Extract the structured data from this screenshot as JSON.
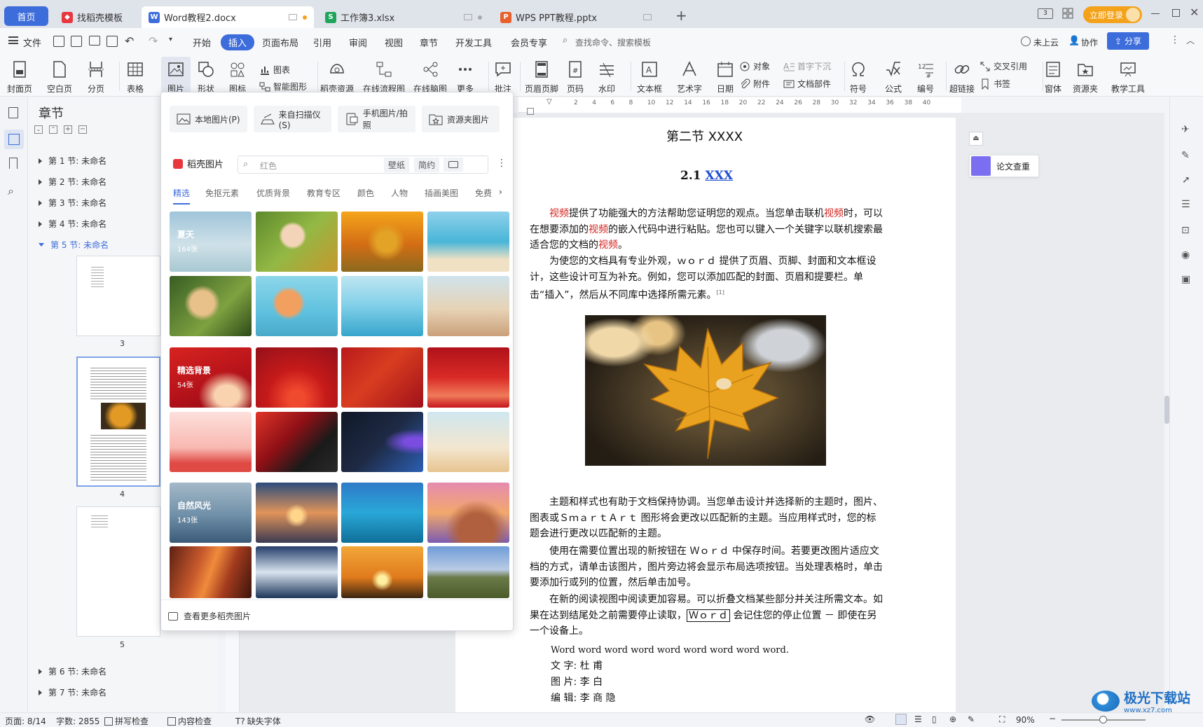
{
  "tabs": {
    "home": "首页",
    "t1": "找稻壳模板",
    "t2": "Word教程2.docx",
    "t3": "工作簿3.xlsx",
    "t4": "WPS PPT教程.pptx",
    "login": "立即登录"
  },
  "menu": {
    "file": "文件",
    "items": [
      "开始",
      "插入",
      "页面布局",
      "引用",
      "审阅",
      "视图",
      "章节",
      "开发工具",
      "会员专享"
    ],
    "search": "查找命令、搜索模板",
    "cloud": "未上云",
    "collab": "协作",
    "share": "分享"
  },
  "ribbon": {
    "cover": "封面页",
    "blank": "空白页",
    "pagebreak": "分页",
    "table": "表格",
    "picture": "图片",
    "shape": "形状",
    "icons": "图标",
    "chart": "图表",
    "smartart": "智能图形",
    "docer": "稻壳资源",
    "flow": "在线流程图",
    "mind": "在线脑图",
    "more": "更多",
    "comment": "批注",
    "headerfooter": "页眉页脚",
    "pagenum": "页码",
    "watermark": "水印",
    "textbox": "文本框",
    "wordart": "艺术字",
    "date": "日期",
    "object": "对象",
    "attach": "附件",
    "dropcap": "首字下沉",
    "docpart": "文档部件",
    "symbol": "符号",
    "formula": "公式",
    "number": "编号",
    "hyperlink": "超链接",
    "crossref": "交叉引用",
    "bookmark": "书签",
    "window": "窗体",
    "resource": "资源夹",
    "teach": "教学工具"
  },
  "nav": {
    "title": "章节",
    "sections": [
      "第 1 节: 未命名",
      "第 2 节: 未命名",
      "第 3 节: 未命名",
      "第 4 节: 未命名",
      "第 5 节: 未命名",
      "第 6 节: 未命名",
      "第 7 节: 未命名"
    ],
    "page_nums": [
      "3",
      "4",
      "5"
    ]
  },
  "ruler": [
    "2",
    "4",
    "6",
    "8",
    "10",
    "12",
    "14",
    "16",
    "18",
    "20",
    "22",
    "24",
    "26",
    "28",
    "30",
    "32",
    "34",
    "36",
    "38",
    "40"
  ],
  "popup": {
    "local": "本地图片(P)",
    "scanner": "来自扫描仪(S)",
    "phone": "手机图片/拍照",
    "resource": "资源夹图片",
    "brand": "稻壳图片",
    "search_placeholder": "红色",
    "tag1": "壁纸",
    "tag2": "简约",
    "cats": [
      "精选",
      "免抠元素",
      "优质背景",
      "教育专区",
      "颜色",
      "人物",
      "插画美图",
      "免费"
    ],
    "summer": "夏天",
    "summer_n": "164张",
    "bg": "精选背景",
    "bg_n": "54张",
    "nature": "自然风光",
    "nature_n": "143张",
    "more": "查看更多稻壳图片"
  },
  "doc": {
    "heading": "第二节 XXXX",
    "sub_num": "2.1",
    "sub_title": "XXX",
    "p1a": "视频",
    "p1b": "提供了功能强大的方法帮助您证明您的观点。当您单击联机",
    "p1c": "视频",
    "p1d": "时，可以在想要添加的",
    "p1e": "视频",
    "p1f": "的嵌入代码中进行粘贴。您也可以键入一个关键字以联机搜索最适合您的文档的",
    "p1g": "视频",
    "p1h": "。",
    "p2": "为使您的文档具有专业外观，ｗｏｒｄ 提供了页眉、页脚、封面和文本框设计，这些设计可互为补充。例如，您可以添加匹配的封面、页眉和提要栏。单击“插入”，然后从不同库中选择所需元素。",
    "p2ref": "[1]",
    "p3": "主题和样式也有助于文档保持协调。当您单击设计并选择新的主题时，图片、图表或ＳｍａｒｔＡｒｔ 图形将会更改以匹配新的主题。当应用样式时，您的标题会进行更改以匹配新的主题。",
    "p4": "使用在需要位置出现的新按钮在 Ｗｏｒｄ 中保存时间。若要更改图片适应文档的方式，请单击该图片，图片旁边将会显示布局选项按钮。当处理表格时，单击要添加行或列的位置，然后单击加号。",
    "p5a": "在新的阅读视图中阅读更加容易。可以折叠文档某些部分并关注所需文本。如果在达到结尾处之前需要停止读取，",
    "p5b": "Ｗｏｒｄ",
    "p5c": " 会记住您的停止位置 － 即使在另一个设备上。",
    "p6": "Word word word word word word word word word.",
    "l1": "文 字: 杜    甫",
    "l2": "图 片: 李    白",
    "l3": "编 辑: 李 商 隐"
  },
  "right_panel": {
    "check": "论文查重"
  },
  "status": {
    "page": "页面: 8/14",
    "words": "字数: 2855",
    "spell": "拼写检查",
    "content": "内容检查",
    "font": "缺失字体",
    "zoom": "90%"
  },
  "watermark": {
    "site": "极光下载站",
    "url": "www.xz7.com"
  },
  "colors": {
    "accent": "#3d6ddb",
    "login": "#f3a21a",
    "docer_red": "#e8373d",
    "link_blue": "#1f4ecf"
  }
}
